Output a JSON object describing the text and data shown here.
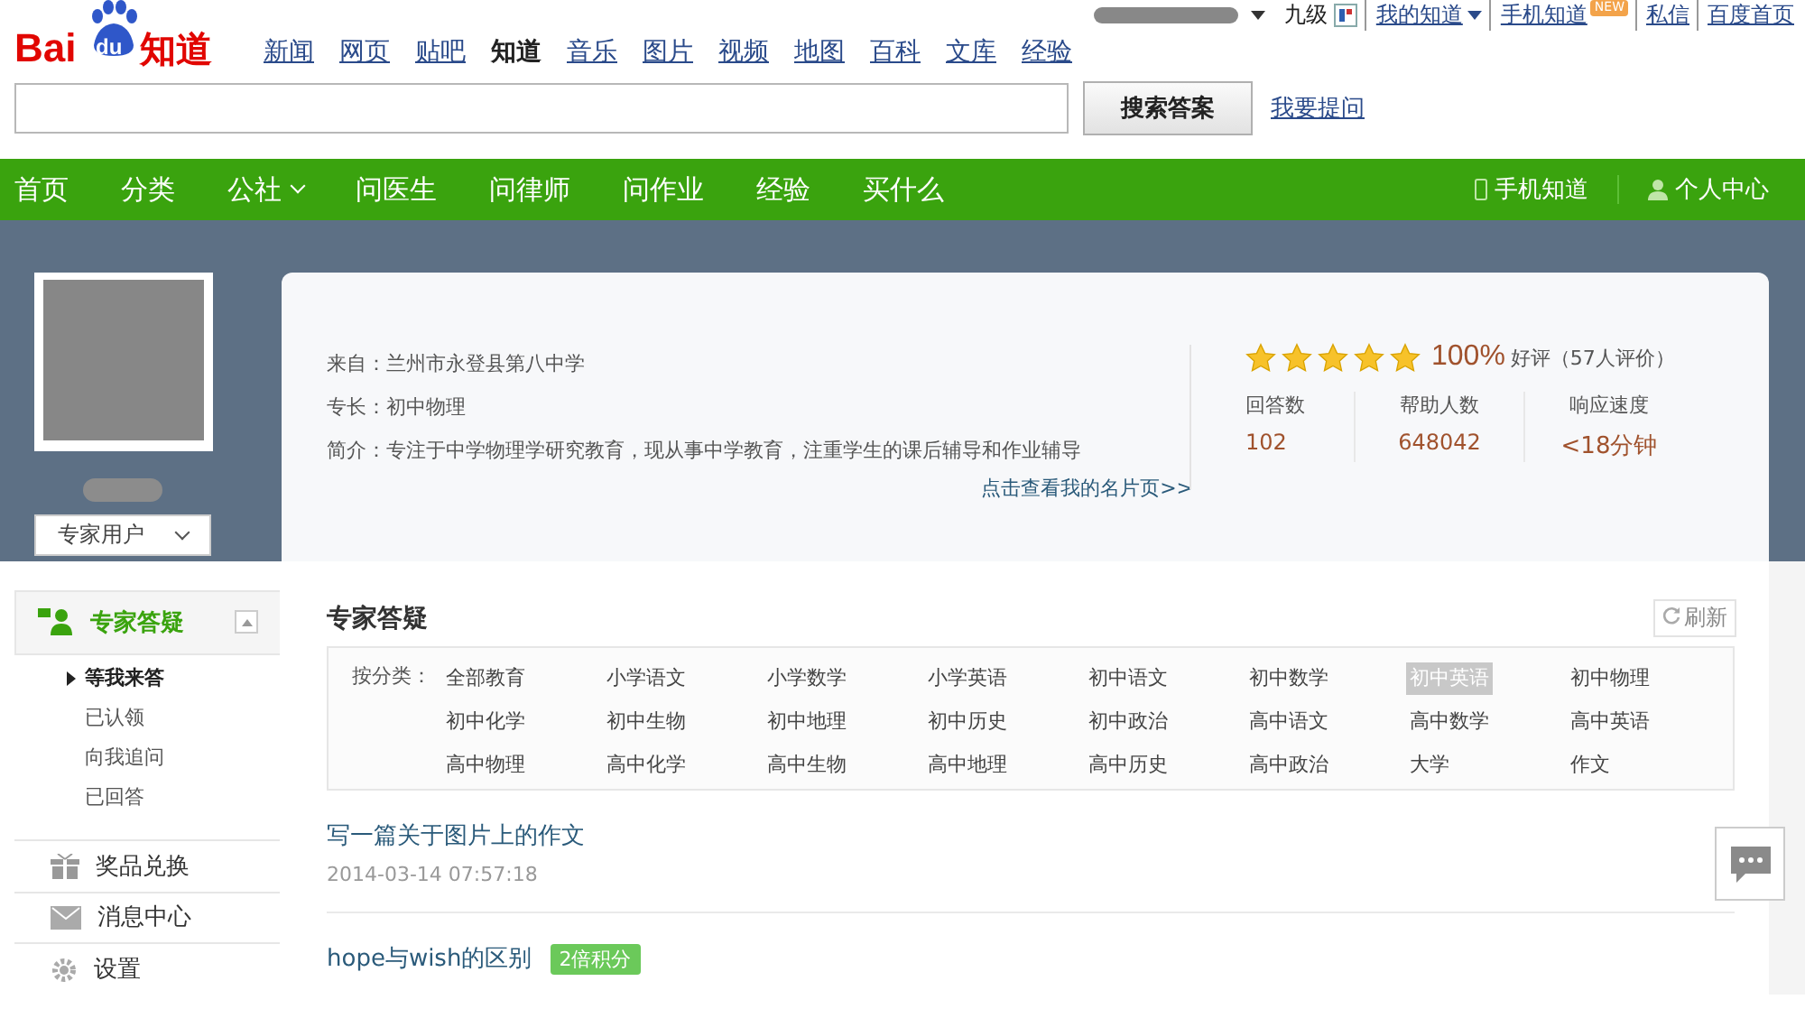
{
  "topbar": {
    "level": "九级",
    "links": [
      {
        "label": "我的知道",
        "dropdown": true
      },
      {
        "label": "手机知道",
        "badge": "NEW",
        "dropdown": false
      },
      {
        "label": "私信",
        "dropdown": false
      },
      {
        "label": "百度首页",
        "dropdown": false
      }
    ]
  },
  "logo": {
    "brand": "Bai",
    "paw": "du",
    "product": "知道"
  },
  "channels": [
    {
      "label": "新闻",
      "selected": false
    },
    {
      "label": "网页",
      "selected": false
    },
    {
      "label": "贴吧",
      "selected": false
    },
    {
      "label": "知道",
      "selected": true
    },
    {
      "label": "音乐",
      "selected": false
    },
    {
      "label": "图片",
      "selected": false
    },
    {
      "label": "视频",
      "selected": false
    },
    {
      "label": "地图",
      "selected": false
    },
    {
      "label": "百科",
      "selected": false
    },
    {
      "label": "文库",
      "selected": false
    },
    {
      "label": "经验",
      "selected": false
    }
  ],
  "search": {
    "button": "搜索答案",
    "ask_link": "我要提问"
  },
  "nav": {
    "items": [
      {
        "label": "首页",
        "dropdown": false
      },
      {
        "label": "分类",
        "dropdown": false
      },
      {
        "label": "公社",
        "dropdown": true
      },
      {
        "label": "问医生",
        "dropdown": false
      },
      {
        "label": "问律师",
        "dropdown": false
      },
      {
        "label": "问作业",
        "dropdown": false
      },
      {
        "label": "经验",
        "dropdown": false
      },
      {
        "label": "买什么",
        "dropdown": false
      }
    ],
    "right": [
      {
        "label": "手机知道",
        "kind": "phone"
      },
      {
        "label": "个人中心",
        "kind": "person"
      }
    ]
  },
  "profile": {
    "role": "专家用户",
    "from": "来自：兰州市永登县第八中学",
    "specialty": "专长：初中物理",
    "intro": "简介：专注于中学物理学研究教育，现从事中学教育，注重学生的课后辅导和作业辅导",
    "card_link": "点击查看我的名片页>>",
    "stars": 5,
    "rate": "100%",
    "rate_label": "好评（57人评价）",
    "stats": [
      {
        "label": "回答数",
        "value": "102"
      },
      {
        "label": "帮助人数",
        "value": "648042"
      },
      {
        "label": "响应速度",
        "value": "<18分钟"
      }
    ]
  },
  "sidebar": {
    "sections": [
      {
        "label": "专家答疑",
        "kind": "experts",
        "expanded": true,
        "children": [
          {
            "label": "等我来答",
            "selected": true
          },
          {
            "label": "已认领",
            "selected": false
          },
          {
            "label": "向我追问",
            "selected": false
          },
          {
            "label": "已回答",
            "selected": false
          }
        ]
      },
      {
        "label": "奖品兑换",
        "kind": "gift",
        "expanded": false
      },
      {
        "label": "消息中心",
        "kind": "mail",
        "expanded": false
      },
      {
        "label": "设置",
        "kind": "gear",
        "expanded": false
      }
    ]
  },
  "panel": {
    "title": "专家答疑",
    "refresh": "刷新",
    "filter_label": "按分类：",
    "categories": [
      {
        "label": "全部教育",
        "selected": false
      },
      {
        "label": "小学语文",
        "selected": false
      },
      {
        "label": "小学数学",
        "selected": false
      },
      {
        "label": "小学英语",
        "selected": false
      },
      {
        "label": "初中语文",
        "selected": false
      },
      {
        "label": "初中数学",
        "selected": false
      },
      {
        "label": "初中英语",
        "selected": true
      },
      {
        "label": "初中物理",
        "selected": false
      },
      {
        "label": "初中化学",
        "selected": false
      },
      {
        "label": "初中生物",
        "selected": false
      },
      {
        "label": "初中地理",
        "selected": false
      },
      {
        "label": "初中历史",
        "selected": false
      },
      {
        "label": "初中政治",
        "selected": false
      },
      {
        "label": "高中语文",
        "selected": false
      },
      {
        "label": "高中数学",
        "selected": false
      },
      {
        "label": "高中英语",
        "selected": false
      },
      {
        "label": "高中物理",
        "selected": false
      },
      {
        "label": "高中化学",
        "selected": false
      },
      {
        "label": "高中生物",
        "selected": false
      },
      {
        "label": "高中地理",
        "selected": false
      },
      {
        "label": "高中历史",
        "selected": false
      },
      {
        "label": "高中政治",
        "selected": false
      },
      {
        "label": "大学",
        "selected": false
      },
      {
        "label": "作文",
        "selected": false
      }
    ],
    "questions": [
      {
        "title": "写一篇关于图片上的作文",
        "time": "2014-03-14 07:57:18"
      },
      {
        "title": "hope与wish的区别",
        "badge": "2倍积分"
      }
    ]
  }
}
